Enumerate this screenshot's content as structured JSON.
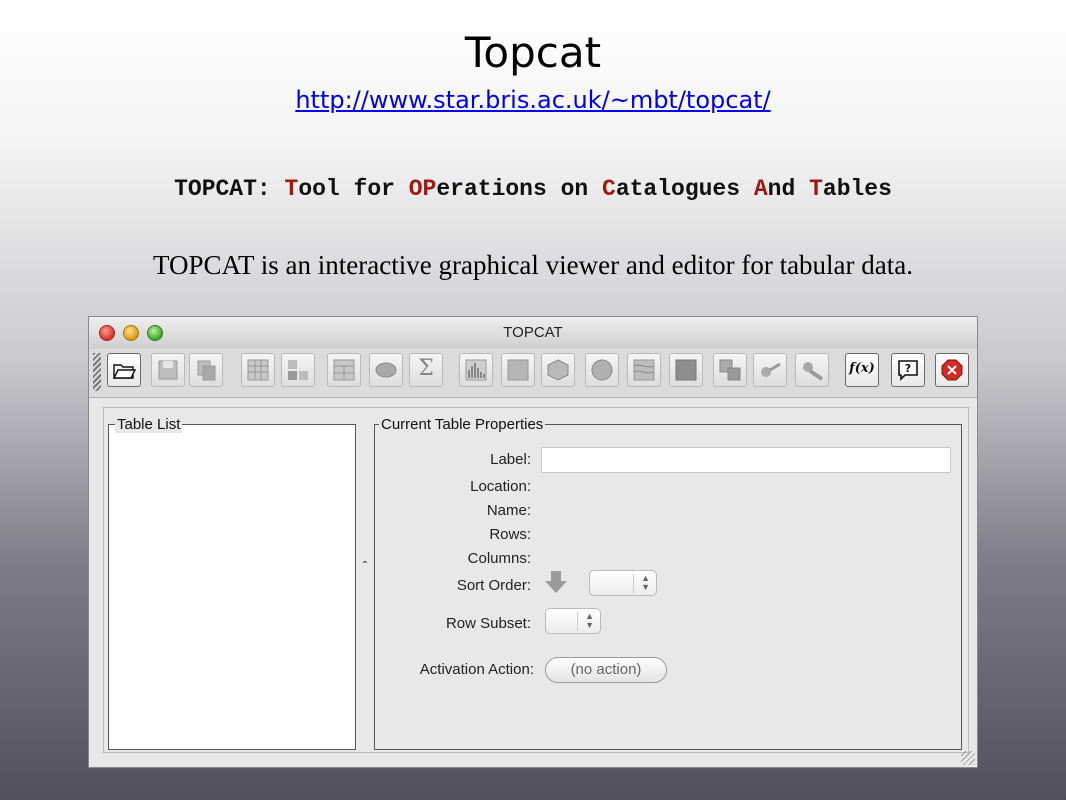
{
  "slide": {
    "title": "Topcat",
    "link": "http://www.star.bris.ac.uk/~mbt/topcat/",
    "acronym": {
      "p1": "TOPCAT: ",
      "t": "T",
      "p2": "ool for ",
      "op": "OP",
      "p3": "erations on ",
      "c": "C",
      "p4": "atalogues ",
      "a": "A",
      "p5": "nd ",
      "t2": "T",
      "p6": "ables"
    },
    "tagline": "TOPCAT is an interactive graphical viewer and editor for tabular data."
  },
  "window": {
    "title": "TOPCAT",
    "toolbar": {
      "fx_label": "f(x)",
      "sigma_label": "Σ",
      "help_label": "?",
      "icons": [
        "open-icon",
        "save-icon",
        "duplicate-icon",
        "table-view-icon",
        "params-view-icon",
        "columns-view-icon",
        "subsets-icon",
        "stats-icon",
        "histogram-icon",
        "plot-2d-icon",
        "plot-3d-icon",
        "sphere-plot-icon",
        "density-map-icon",
        "match-pair-icon",
        "match-multi-icon",
        "match-internal-icon",
        "cone-search-icon",
        "synonym-icon",
        "function-icon",
        "help-icon",
        "exit-icon"
      ]
    },
    "table_list": {
      "legend": "Table List"
    },
    "properties": {
      "legend": "Current Table Properties",
      "label_label": "Label:",
      "label_value": "",
      "location_label": "Location:",
      "name_label": "Name:",
      "rows_label": "Rows:",
      "columns_label": "Columns:",
      "sort_label": "Sort Order:",
      "subset_label": "Row Subset:",
      "activation_label": "Activation Action:",
      "activation_value": "(no action)"
    },
    "colors": {
      "accent_red": "#9b1b10",
      "link_blue": "#0000ee"
    }
  }
}
